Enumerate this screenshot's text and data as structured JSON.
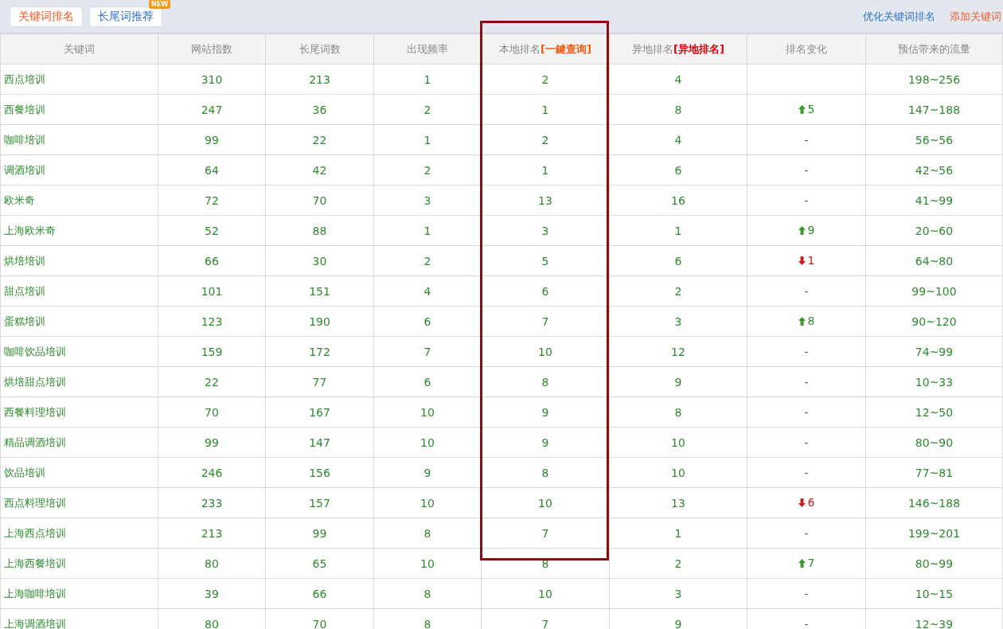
{
  "tabs": [
    {
      "label": "关键词排名",
      "selected": true
    },
    {
      "label": "长尾词推荐",
      "selected": false,
      "badge": "NEW"
    }
  ],
  "actions": [
    {
      "label": "优化关键词排名",
      "kind": "primary"
    },
    {
      "label": "添加关键词",
      "kind": "accent"
    }
  ],
  "table": {
    "columns": [
      {
        "label": "关键词"
      },
      {
        "label": "网站指数"
      },
      {
        "label": "长尾词数"
      },
      {
        "label": "出现频率"
      },
      {
        "label": "本地排名",
        "link": "[一鍵查询]",
        "kind": "orange"
      },
      {
        "label": "异地排名",
        "link": "[异地排名]",
        "kind": "red"
      },
      {
        "label": "排名变化"
      },
      {
        "label": "预估带来的流量"
      }
    ],
    "rows": [
      {
        "keyword": "西点培训",
        "index": "310",
        "longtail": "213",
        "freq": "1",
        "local": "2",
        "remote": "4",
        "traffic": "198~256"
      },
      {
        "keyword": "西餐培训",
        "index": "247",
        "longtail": "36",
        "freq": "2",
        "local": "1",
        "remote": "8",
        "change": {
          "kind": "up",
          "text": "5"
        },
        "traffic": "147~188"
      },
      {
        "keyword": "咖啡培训",
        "index": "99",
        "longtail": "22",
        "freq": "1",
        "local": "2",
        "remote": "4",
        "change": {
          "kind": "none",
          "text": "-"
        },
        "traffic": "56~56"
      },
      {
        "keyword": "调酒培训",
        "index": "64",
        "longtail": "42",
        "freq": "2",
        "local": "1",
        "remote": "6",
        "change": {
          "kind": "none",
          "text": "-"
        },
        "traffic": "42~56"
      },
      {
        "keyword": "欧米奇",
        "index": "72",
        "longtail": "70",
        "freq": "3",
        "local": "13",
        "remote": "16",
        "change": {
          "kind": "none",
          "text": "-"
        },
        "traffic": "41~99"
      },
      {
        "keyword": "上海欧米奇",
        "index": "52",
        "longtail": "88",
        "freq": "1",
        "local": "3",
        "remote": "1",
        "change": {
          "kind": "up",
          "text": "9"
        },
        "traffic": "20~60"
      },
      {
        "keyword": "烘培培训",
        "index": "66",
        "longtail": "30",
        "freq": "2",
        "local": "5",
        "remote": "6",
        "change": {
          "kind": "down",
          "text": "1"
        },
        "traffic": "64~80"
      },
      {
        "keyword": "甜点培训",
        "index": "101",
        "longtail": "151",
        "freq": "4",
        "local": "6",
        "remote": "2",
        "change": {
          "kind": "none",
          "text": "-"
        },
        "traffic": "99~100"
      },
      {
        "keyword": "蛋糕培训",
        "index": "123",
        "longtail": "190",
        "freq": "6",
        "local": "7",
        "remote": "3",
        "change": {
          "kind": "up",
          "text": "8"
        },
        "traffic": "90~120"
      },
      {
        "keyword": "咖啡饮品培训",
        "index": "159",
        "longtail": "172",
        "freq": "7",
        "local": "10",
        "remote": "12",
        "change": {
          "kind": "none",
          "text": "-"
        },
        "traffic": "74~99"
      },
      {
        "keyword": "烘培甜点培训",
        "index": "22",
        "longtail": "77",
        "freq": "6",
        "local": "8",
        "remote": "9",
        "change": {
          "kind": "none",
          "text": "-"
        },
        "traffic": "10~33"
      },
      {
        "keyword": "西餐料理培训",
        "index": "70",
        "longtail": "167",
        "freq": "10",
        "local": "9",
        "remote": "8",
        "change": {
          "kind": "none",
          "text": "-"
        },
        "traffic": "12~50"
      },
      {
        "keyword": "精品调酒培训",
        "index": "99",
        "longtail": "147",
        "freq": "10",
        "local": "9",
        "remote": "10",
        "change": {
          "kind": "none",
          "text": "-"
        },
        "traffic": "80~90"
      },
      {
        "keyword": "饮品培训",
        "index": "246",
        "longtail": "156",
        "freq": "9",
        "local": "8",
        "remote": "10",
        "change": {
          "kind": "none",
          "text": "-"
        },
        "traffic": "77~81"
      },
      {
        "keyword": "西点料理培训",
        "index": "233",
        "longtail": "157",
        "freq": "10",
        "local": "10",
        "remote": "13",
        "change": {
          "kind": "down",
          "text": "6"
        },
        "traffic": "146~188"
      },
      {
        "keyword": "上海西点培训",
        "index": "213",
        "longtail": "99",
        "freq": "8",
        "local": "7",
        "remote": "1",
        "change": {
          "kind": "none",
          "text": "-"
        },
        "traffic": "199~201"
      },
      {
        "keyword": "上海西餐培训",
        "index": "80",
        "longtail": "65",
        "freq": "10",
        "local": "8",
        "remote": "2",
        "change": {
          "kind": "up",
          "text": "7"
        },
        "traffic": "80~99"
      },
      {
        "keyword": "上海咖啡培训",
        "index": "39",
        "longtail": "66",
        "freq": "8",
        "local": "10",
        "remote": "3",
        "change": {
          "kind": "none",
          "text": "-"
        },
        "traffic": "10~15"
      },
      {
        "keyword": "上海调酒培训",
        "index": "80",
        "longtail": "70",
        "freq": "8",
        "local": "7",
        "remote": "9",
        "change": {
          "kind": "none",
          "text": "-"
        },
        "traffic": "12~39"
      }
    ]
  }
}
